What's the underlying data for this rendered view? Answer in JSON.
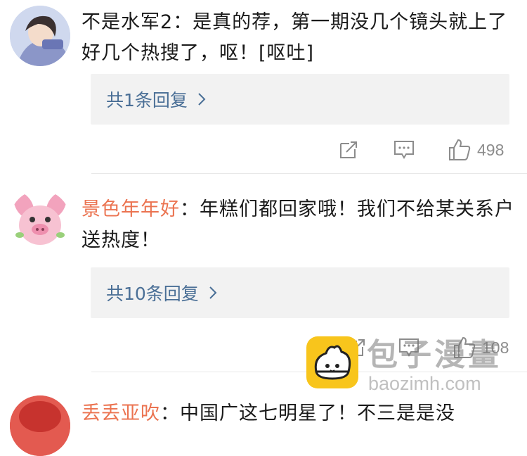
{
  "comments": [
    {
      "username": "不是水军2",
      "text": "：是真的荐，第一期没几个镜头就上了好几个热搜了，呕！[呕吐]",
      "replies_label": "共1条回复",
      "likes": "498"
    },
    {
      "username": "景色年年好",
      "text": "：年糕们都回家哦！我们不给某关系户送热度！",
      "replies_label": "共10条回复",
      "likes": "108"
    },
    {
      "username": "丢丢亚吹",
      "text": "：中国广这七明星了！不三是是没"
    }
  ],
  "watermark": {
    "name": "包子漫畫",
    "url": "baozimh.com"
  },
  "colors": {
    "username": "#eb7350",
    "reply_link": "#4a6f96",
    "icon_gray": "#8c8c8c"
  }
}
